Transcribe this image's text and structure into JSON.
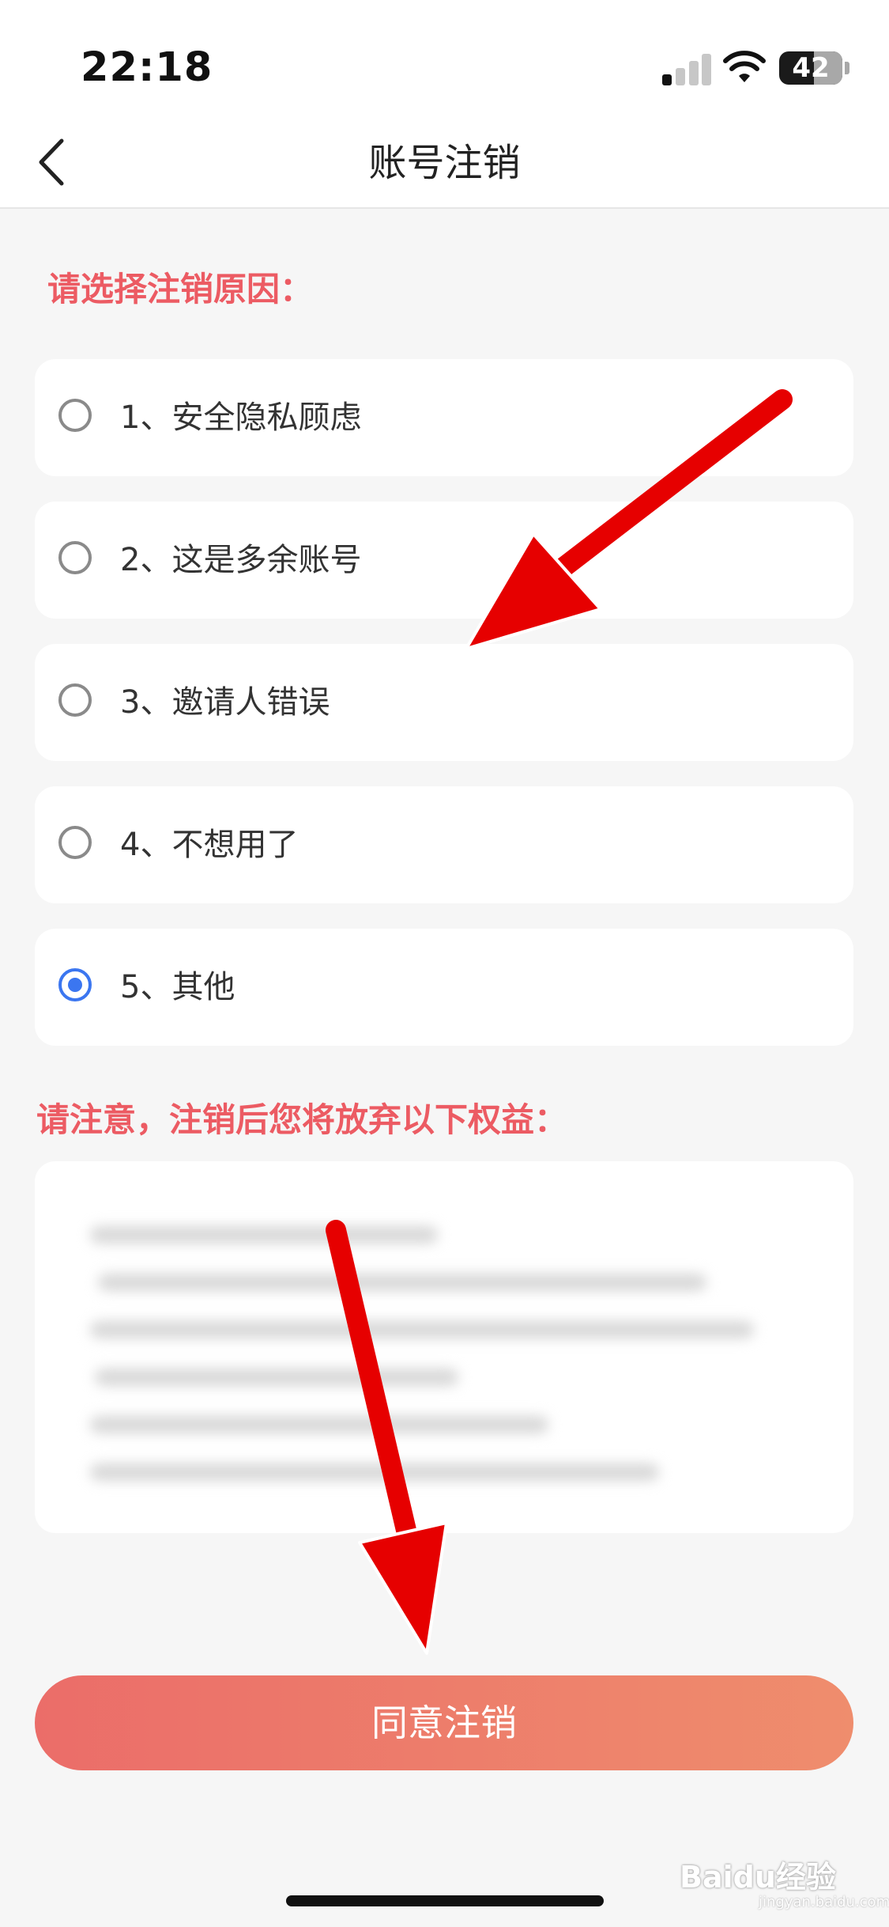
{
  "status_bar": {
    "time": "22:18",
    "battery": "42"
  },
  "nav": {
    "title": "账号注销",
    "back_icon": "chevron-left-icon"
  },
  "reasons": {
    "title": "请选择注销原因：",
    "options": [
      {
        "label": "1、安全隐私顾虑",
        "selected": false
      },
      {
        "label": "2、这是多余账号",
        "selected": false
      },
      {
        "label": "3、邀请人错误",
        "selected": false
      },
      {
        "label": "4、不想用了",
        "selected": false
      },
      {
        "label": "5、其他",
        "selected": true
      }
    ]
  },
  "benefits": {
    "title": "请注意，注销后您将放弃以下权益："
  },
  "agree_button": "同意注销",
  "watermark": {
    "brand": "Baidu经验",
    "site": "jingyan.baidu.com"
  },
  "colors": {
    "accent_red": "#ec5b63",
    "radio_selected": "#3b76f0",
    "button_start": "#eb6d69",
    "button_end": "#ef8d6d",
    "annotation_arrow": "#e60000"
  }
}
